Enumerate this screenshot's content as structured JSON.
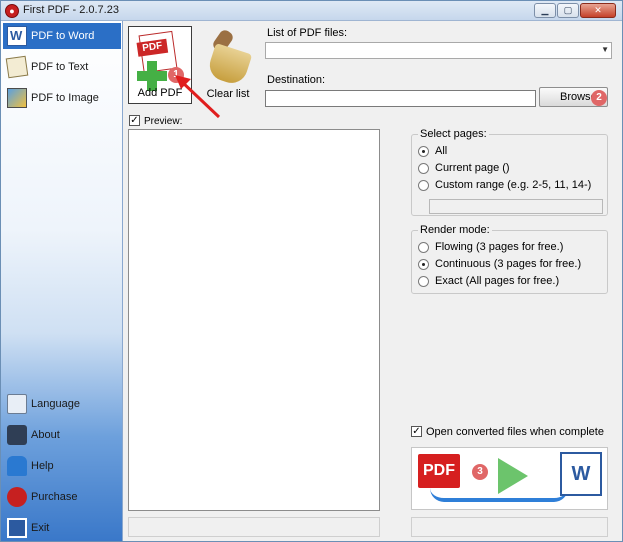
{
  "window": {
    "title": "First PDF - 2.0.7.23",
    "app_icon_glyph": "●",
    "controls": {
      "minimize": "▁",
      "maximize": "▢",
      "close": "✕"
    }
  },
  "sidebar": {
    "top_items": [
      {
        "label": "PDF to Word",
        "icon": "word-icon",
        "active": true
      },
      {
        "label": "PDF to Text",
        "icon": "text-icon",
        "active": false
      },
      {
        "label": "PDF to Image",
        "icon": "image-icon",
        "active": false
      }
    ],
    "bottom_items": [
      {
        "label": "Language",
        "icon": "language-icon"
      },
      {
        "label": "About",
        "icon": "about-icon"
      },
      {
        "label": "Help",
        "icon": "help-icon"
      },
      {
        "label": "Purchase",
        "icon": "purchase-icon"
      },
      {
        "label": "Exit",
        "icon": "exit-icon"
      }
    ]
  },
  "toolbar": {
    "add_pdf_label": "Add PDF",
    "add_pdf_icon_text": "PDF",
    "add_pdf_badge": "1",
    "clear_list_label": "Clear list"
  },
  "files": {
    "list_label": "List of PDF files:",
    "list_value": "",
    "destination_label": "Destination:",
    "destination_value": "",
    "browse_label": "Browse",
    "browse_badge": "2"
  },
  "preview": {
    "label": "Preview:",
    "checked": true,
    "check_glyph": "✓"
  },
  "select_pages": {
    "title": "Select pages:",
    "options": [
      {
        "label": "All",
        "selected": true
      },
      {
        "label": "Current page ()",
        "selected": false
      },
      {
        "label": "Custom range (e.g. 2-5, 11, 14-)",
        "selected": false
      }
    ],
    "range_value": ""
  },
  "render_mode": {
    "title": "Render mode:",
    "options": [
      {
        "label": "Flowing (3 pages for free.)",
        "selected": false
      },
      {
        "label": "Continuous (3 pages for free.)",
        "selected": true
      },
      {
        "label": "Exact (All pages for free.)",
        "selected": false
      }
    ]
  },
  "open_converted": {
    "label": "Open converted files when complete",
    "checked": true,
    "check_glyph": "✓"
  },
  "convert": {
    "pdf_text": "PDF",
    "word_text": "W",
    "badge": "3"
  },
  "colors": {
    "accent": "#2b6fc6",
    "badge": "#e06767",
    "pdf_red": "#d61f1f",
    "play_green": "#6cc46c"
  }
}
